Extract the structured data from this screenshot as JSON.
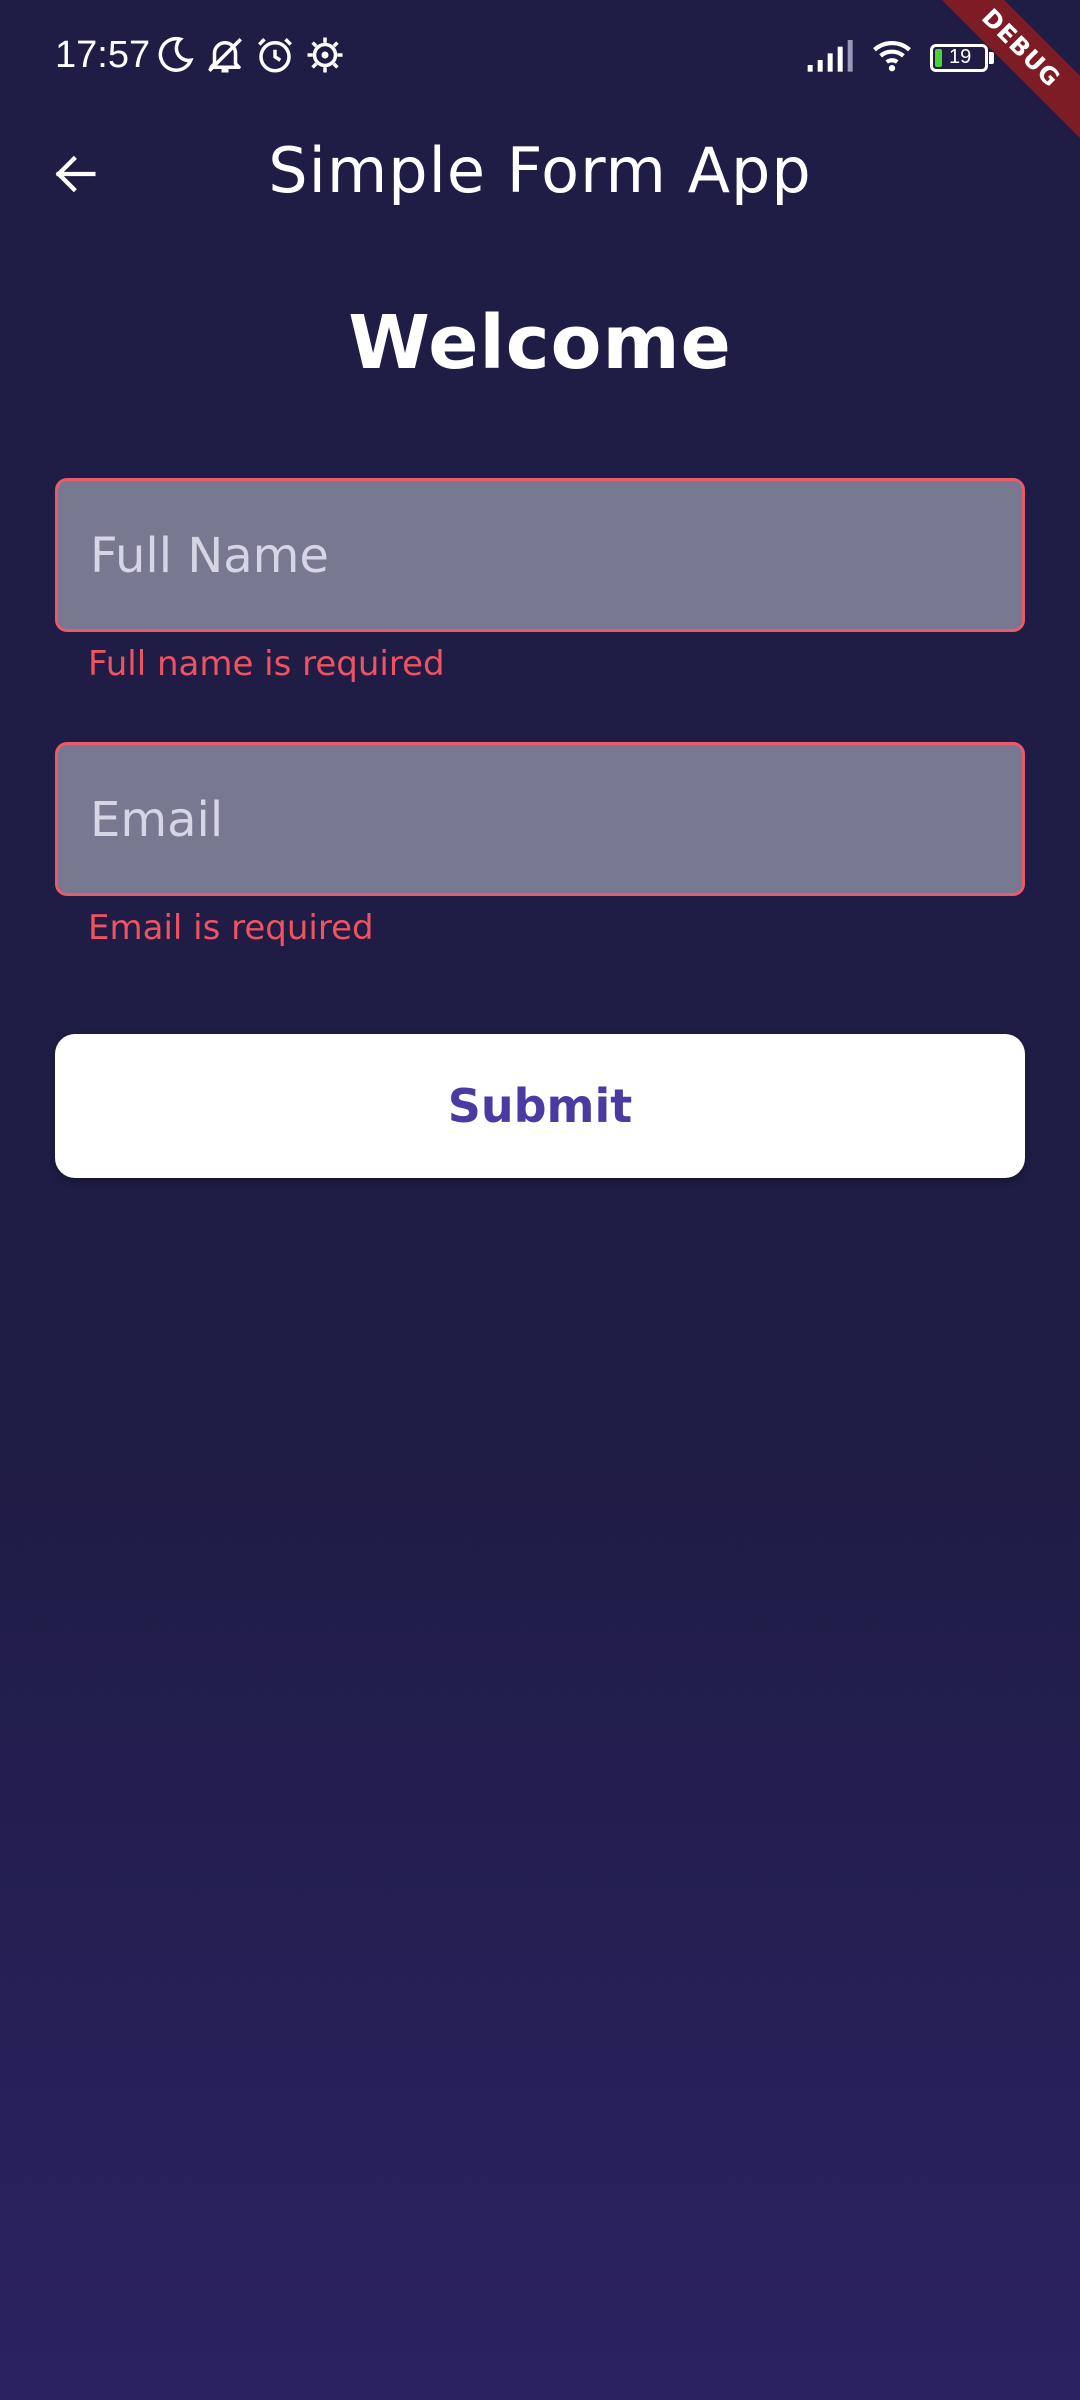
{
  "status_bar": {
    "time": "17:57",
    "icons": [
      "moon-icon",
      "bell-off-icon",
      "alarm-icon",
      "settings-gear-icon",
      "signal-icon",
      "wifi-icon"
    ],
    "battery_level": "19",
    "battery_fill_color": "#4cd137"
  },
  "debug_banner": {
    "label": "DEBUG",
    "color": "#7e1c26"
  },
  "app_bar": {
    "title": "Simple Form App",
    "back_icon": "arrow-left-icon"
  },
  "form": {
    "heading": "Welcome",
    "full_name": {
      "placeholder": "Full Name",
      "value": "",
      "error": "Full name is required"
    },
    "email": {
      "placeholder": "Email",
      "value": "",
      "error": "Email is required"
    },
    "submit_label": "Submit"
  },
  "colors": {
    "background": "#1f1c45",
    "field_fill": "#787890",
    "error": "#ef5361",
    "button_text": "#4a3aa1"
  }
}
